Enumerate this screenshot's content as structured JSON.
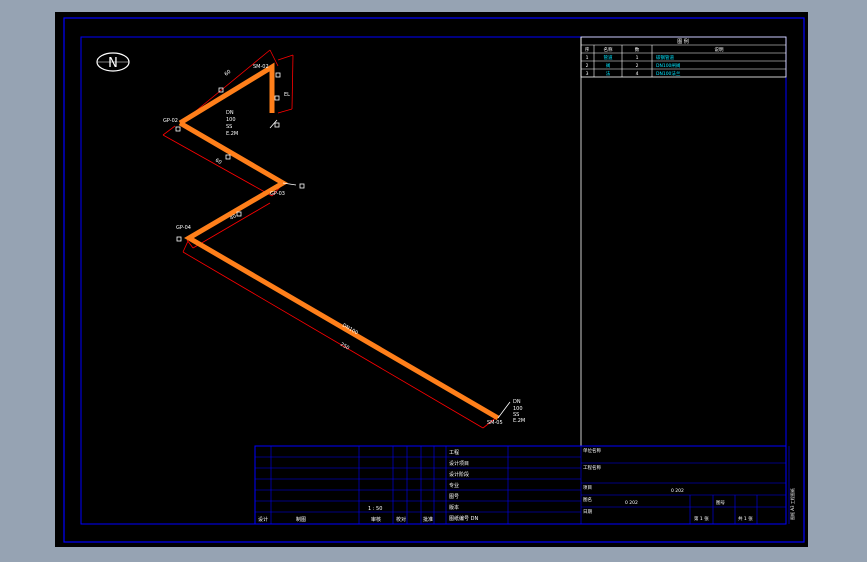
{
  "colors": {
    "background": "#96a3b3",
    "sheet": "#000000",
    "frame": "#0000ff",
    "pipe": "#ff7f1a",
    "dimension": "#ff0000",
    "text": "#ffffff",
    "table_text": "#00e5ff"
  },
  "north_symbol": {
    "letter": "N"
  },
  "pipe_labels": {
    "start_tag": "SM-02",
    "node1": "GP-02",
    "node2": "GP-03",
    "node3": "GP-04",
    "end_tag": "SM-05",
    "seg1": "60",
    "seg2": "60",
    "seg3": "40",
    "seg4": "250",
    "seg_long": "DN100",
    "elev_a": "EL",
    "elev_b": "EL",
    "callout1": [
      "DN",
      "100",
      "SS",
      "E.2M"
    ],
    "callout2": [
      "DN",
      "100",
      "SS",
      "E.2M"
    ]
  },
  "legend": {
    "title": "图 例",
    "headers": [
      "序",
      "名称",
      "数",
      "说明"
    ],
    "rows": [
      {
        "no": "1",
        "name": "管道",
        "qty": "1",
        "note": "碳钢管道"
      },
      {
        "no": "2",
        "name": "阀",
        "qty": "2",
        "note": "DN100闸阀"
      },
      {
        "no": "3",
        "name": "法",
        "qty": "4",
        "note": "DN100法兰"
      }
    ]
  },
  "title_block": {
    "left_labels": [
      "设计",
      "制图"
    ],
    "mid_labels": [
      "审核",
      "校对",
      "批准"
    ],
    "scale_note": "1 : 50",
    "center_rows": [
      "工程",
      "设计项目",
      "设计阶段",
      "专业",
      "图号",
      "版本",
      "图纸编号 DN"
    ],
    "right_rows": [
      "单位名称",
      "工程名称",
      "项目",
      "图名",
      "日期",
      "图号"
    ],
    "right_values": [
      "",
      "",
      "",
      "0 202",
      "0 202",
      ""
    ],
    "sheet_info": "第 1 张",
    "sheet_info2": "共 1 张",
    "side_text": "图框 A3 工程图纸"
  }
}
